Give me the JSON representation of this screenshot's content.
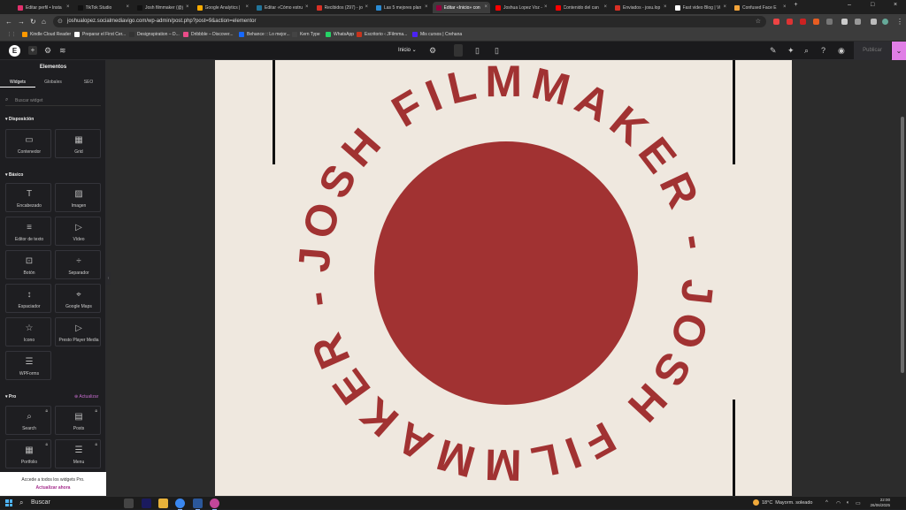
{
  "browser": {
    "tabs": [
      {
        "title": "Editar perfil • Insta",
        "color": "#e1306c"
      },
      {
        "title": "TikTok Studio",
        "color": "#111111"
      },
      {
        "title": "Josh filmmaker (@j",
        "color": "#111111"
      },
      {
        "title": "Google Analytics |",
        "color": "#f9ab00"
      },
      {
        "title": "Editar «Cómo estru",
        "color": "#21759b"
      },
      {
        "title": "Recibidos (297) - jo",
        "color": "#d93025"
      },
      {
        "title": "Las 5 mejores plan",
        "color": "#2a8bd4"
      },
      {
        "title": "Editar «Inicio» con",
        "color": "#92003b"
      },
      {
        "title": "Joshua Lopez Voz -",
        "color": "#ff0000"
      },
      {
        "title": "Contenido del can",
        "color": "#ff0000"
      },
      {
        "title": "Enviados - josu.lop",
        "color": "#d93025"
      },
      {
        "title": "Fast video Blog | Vi",
        "color": "#ffffff"
      },
      {
        "title": "Confused Face E",
        "color": "#f2a33a"
      }
    ],
    "new_tab_label": "+",
    "url": "joshualopez.socialmediavigo.com/wp-admin/post.php?post=9&action=elementor",
    "bookmarks": [
      {
        "label": "Kindle Cloud Reader",
        "color": "#ff9900"
      },
      {
        "label": "Preparar el First Cer...",
        "color": "#ffffff"
      },
      {
        "label": "Designspiration – D...",
        "color": "#333333"
      },
      {
        "label": "Dribbble – Discover...",
        "color": "#ea4c89"
      },
      {
        "label": "Behance :: Lo mejor...",
        "color": "#1769ff"
      },
      {
        "label": "Kern Type",
        "color": "#444444"
      },
      {
        "label": "WhatsApp",
        "color": "#25d366"
      },
      {
        "label": "Escritorio ‹ JFilmma...",
        "color": "#c8341c"
      },
      {
        "label": "Mis cursos | Crehana",
        "color": "#4b22f4"
      }
    ]
  },
  "elementor": {
    "logo": "E",
    "page_selector": "Inicio",
    "publish_label": "Publicar",
    "panel_title": "Elementos",
    "panel_tabs": [
      "Widgets",
      "Globales",
      "SEO"
    ],
    "search_placeholder": "Buscar widget",
    "sections": {
      "layout": "Disposición",
      "basic": "Básico",
      "pro": "Pro",
      "pro_upgrade": "Actualizar"
    },
    "layout_widgets": [
      "Contenedor",
      "Grid"
    ],
    "basic_widgets": [
      "Encabezado",
      "Imagen",
      "Editor de texto",
      "Vídeo",
      "Botón",
      "Separador",
      "Espaciador",
      "Google Maps",
      "Icono",
      "Presto Player Media",
      "WPForms"
    ],
    "pro_widgets": [
      "Search",
      "Posts",
      "Portfolio",
      "Menu"
    ],
    "promo_text": "Accede a todos los widgets Pro.",
    "promo_link": "Actualizar ahora"
  },
  "canvas": {
    "circular_text": "JOSH FILMMAKER - JOSH FILMMAKER -",
    "bg_color": "#efe8df",
    "accent_color": "#a13232"
  },
  "taskbar": {
    "search_label": "Buscar",
    "temperature": "18°C",
    "weather": "Mayorm. soleado",
    "time": "22:00",
    "date": "26/06/2025"
  }
}
